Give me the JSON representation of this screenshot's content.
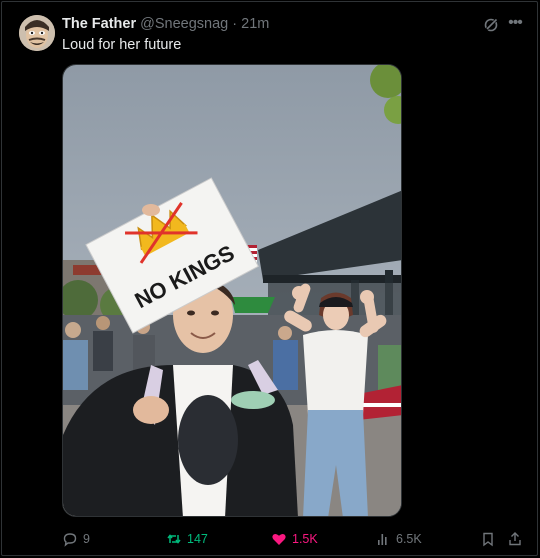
{
  "post": {
    "author_name": "The Father",
    "author_handle": "@Sneegsnag",
    "separator": "·",
    "time": "21m",
    "text": "Loud for her future"
  },
  "media": {
    "sign_text": "NO KINGS"
  },
  "actions": {
    "replies": "9",
    "reposts": "147",
    "likes": "1.5K",
    "views": "6.5K"
  },
  "colors": {
    "background": "#000000",
    "text": "#e7e9ea",
    "muted": "#71767b",
    "repost_active": "#00ba7c",
    "like_active": "#f91880",
    "border": "#2f3336"
  },
  "icons": {
    "reply": "reply-bubble-icon",
    "repost": "repost-arrows-icon",
    "like": "heart-filled-icon",
    "views": "views-bars-icon",
    "bookmark": "bookmark-icon",
    "share": "share-upload-icon",
    "grok": "grok-icon",
    "more": "more-dots-icon"
  }
}
